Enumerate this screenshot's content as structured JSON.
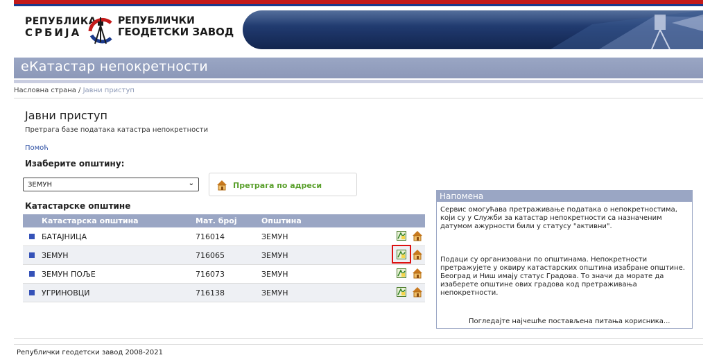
{
  "header": {
    "logo_left_line1": "РЕПУБЛИКА",
    "logo_left_line2": "СРБИЈА",
    "logo_right_line1": "РЕПУБЛИЧКИ",
    "logo_right_line2": "ГЕОДЕТСКИ ЗАВОД"
  },
  "app_title": "еКатастар непокретности",
  "breadcrumb": {
    "home": "Насловна страна",
    "separator": "/",
    "current": "Јавни приступ"
  },
  "page": {
    "title": "Јавни приступ",
    "subtitle": "Претрага базе података катастра непокретности",
    "help": "Помоћ",
    "choose_label": "Изаберите општину:",
    "select_value": "ЗЕМУН",
    "address_search": "Претрага по адреси",
    "cadastral_label": "Катастарске општине"
  },
  "table": {
    "headers": [
      "Катастарска општина",
      "Мат. број",
      "Општина"
    ],
    "rows": [
      {
        "name": "БАТАЈНИЦА",
        "number": "716014",
        "municipality": "ЗЕМУН"
      },
      {
        "name": "ЗЕМУН",
        "number": "716065",
        "municipality": "ЗЕМУН"
      },
      {
        "name": "ЗЕМУН ПОЉЕ",
        "number": "716073",
        "municipality": "ЗЕМУН"
      },
      {
        "name": "УГРИНОВЦИ",
        "number": "716138",
        "municipality": "ЗЕМУН"
      }
    ]
  },
  "note": {
    "title": "Напомена",
    "p1": "Сервис омогућава претраживање података о непокретностима, који су у Служби за катастар непокретности са назначеним датумом ажурности били у статусу \"активни\".",
    "p2": "Подаци су организовани по општинама. Непокретности претражујете у оквиру катастарских општина изабране општине. Београд и Ниш имају статус Градова. То значи да морате да изаберете општине ових градова код претраживања непокретности.",
    "faq_link": "Погледајте најчешће постављена питања корисника..."
  },
  "footer": "Републички геодетски завод 2008-2021",
  "colors": {
    "accent_header": "#9aa6c4",
    "bullet": "#3552b8",
    "address_green": "#5aa02c",
    "top_red": "#c41a1a",
    "highlight": "#dd1111"
  }
}
